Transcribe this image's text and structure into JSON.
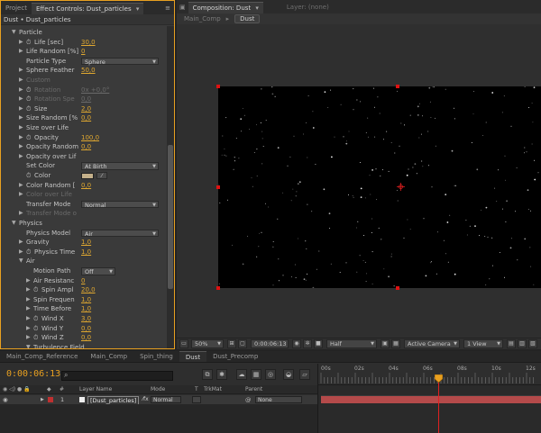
{
  "project_tab": "Project",
  "effect_controls": {
    "tab_label": "Effect Controls: Dust_particles",
    "header": "Dust • Dust_particles",
    "rows": [
      {
        "indent": 1,
        "twirl": "▼",
        "label": "Particle",
        "type": "group"
      },
      {
        "indent": 2,
        "twirl": "▶",
        "stopwatch": true,
        "label": "Life [sec]",
        "value": "30,0"
      },
      {
        "indent": 2,
        "twirl": "▶",
        "label": "Life Random [%]",
        "value": "0"
      },
      {
        "indent": 2,
        "label": "Particle Type",
        "dropdown": "Sphere"
      },
      {
        "indent": 2,
        "twirl": "▶",
        "label": "Sphere Feather",
        "value": "50,0"
      },
      {
        "indent": 2,
        "twirl": "▶",
        "label": "Custom",
        "disabled": true
      },
      {
        "indent": 2,
        "twirl": "▶",
        "stopwatch": true,
        "label": "Rotation",
        "value": "0x +0,0°",
        "disabled": true
      },
      {
        "indent": 2,
        "twirl": "▶",
        "stopwatch": true,
        "label": "Rotation Spe",
        "value": "0,0",
        "disabled": true
      },
      {
        "indent": 2,
        "twirl": "▶",
        "stopwatch": true,
        "label": "Size",
        "value": "2,0"
      },
      {
        "indent": 2,
        "twirl": "▶",
        "label": "Size Random [%",
        "value": "0,0"
      },
      {
        "indent": 2,
        "twirl": "▶",
        "label": "Size over Life"
      },
      {
        "indent": 2,
        "twirl": "▶",
        "stopwatch": true,
        "label": "Opacity",
        "value": "100,0"
      },
      {
        "indent": 2,
        "twirl": "▶",
        "label": "Opacity Random",
        "value": "0,0"
      },
      {
        "indent": 2,
        "twirl": "▶",
        "label": "Opacity over Lif"
      },
      {
        "indent": 2,
        "label": "Set Color",
        "dropdown": "At Birth"
      },
      {
        "indent": 2,
        "stopwatch": true,
        "label": "Color",
        "swatch": true
      },
      {
        "indent": 2,
        "twirl": "▶",
        "label": "Color Random [",
        "value": "0,0"
      },
      {
        "indent": 2,
        "twirl": "▶",
        "label": "Color over Life",
        "disabled": true
      },
      {
        "indent": 2,
        "label": "Transfer Mode",
        "dropdown": "Normal"
      },
      {
        "indent": 2,
        "twirl": "▶",
        "label": "Transfer Mode o",
        "disabled": true
      },
      {
        "indent": 1,
        "twirl": "▼",
        "label": "Physics",
        "type": "group"
      },
      {
        "indent": 2,
        "label": "Physics Model",
        "dropdown": "Air"
      },
      {
        "indent": 2,
        "twirl": "▶",
        "label": "Gravity",
        "value": "1,0"
      },
      {
        "indent": 2,
        "twirl": "▶",
        "stopwatch": true,
        "label": "Physics Time",
        "value": "1,0"
      },
      {
        "indent": 2,
        "twirl": "▼",
        "label": "Air"
      },
      {
        "indent": 3,
        "label": "Motion Path",
        "dropdown": "Off"
      },
      {
        "indent": 3,
        "twirl": "▶",
        "label": "Air Resistanc",
        "value": "0"
      },
      {
        "indent": 3,
        "twirl": "▶",
        "stopwatch": true,
        "label": "Spin Ampl",
        "value": "20,0"
      },
      {
        "indent": 3,
        "twirl": "▶",
        "label": "Spin Frequen",
        "value": "1,0"
      },
      {
        "indent": 3,
        "twirl": "▶",
        "label": "Time Before",
        "value": "1,0"
      },
      {
        "indent": 3,
        "twirl": "▶",
        "stopwatch": true,
        "label": "Wind X",
        "value": "3,0"
      },
      {
        "indent": 3,
        "twirl": "▶",
        "stopwatch": true,
        "label": "Wind Y",
        "value": "0,0"
      },
      {
        "indent": 3,
        "twirl": "▶",
        "stopwatch": true,
        "label": "Wind Z",
        "value": "0,0"
      },
      {
        "indent": 3,
        "twirl": "▼",
        "label": "Turbulence Field"
      }
    ]
  },
  "composition": {
    "tab_label": "Composition: Dust",
    "layer_label": "Layer: (none)",
    "breadcrumbs": [
      "Main_Comp",
      "Dust"
    ],
    "toolbar": {
      "zoom": "50%",
      "timecode": "0:00:06:13",
      "resolution": "Half",
      "camera": "Active Camera",
      "views": "1 View"
    }
  },
  "timeline": {
    "tabs": [
      "Main_Comp_Reference",
      "Main_Comp",
      "Spin_thing",
      "Dust",
      "Dust_Precomp"
    ],
    "active_tab": "Dust",
    "current_time": "0:00:06:13",
    "columns": {
      "hash": "#",
      "name": "Layer Name",
      "mode": "Mode",
      "t": "T",
      "trkmat": "TrkMat",
      "parent": "Parent"
    },
    "layer": {
      "index": "1",
      "name": "[Dust_particles]",
      "mode": "Normal",
      "parent": "None"
    },
    "ruler_labels": [
      "00s",
      "02s",
      "04s",
      "06s",
      "08s",
      "10s",
      "12s"
    ]
  },
  "colors": {
    "accent": "#e8a020",
    "value": "#e0a830",
    "playhead": "#e02020",
    "layer_bar": "#b44a4a"
  }
}
